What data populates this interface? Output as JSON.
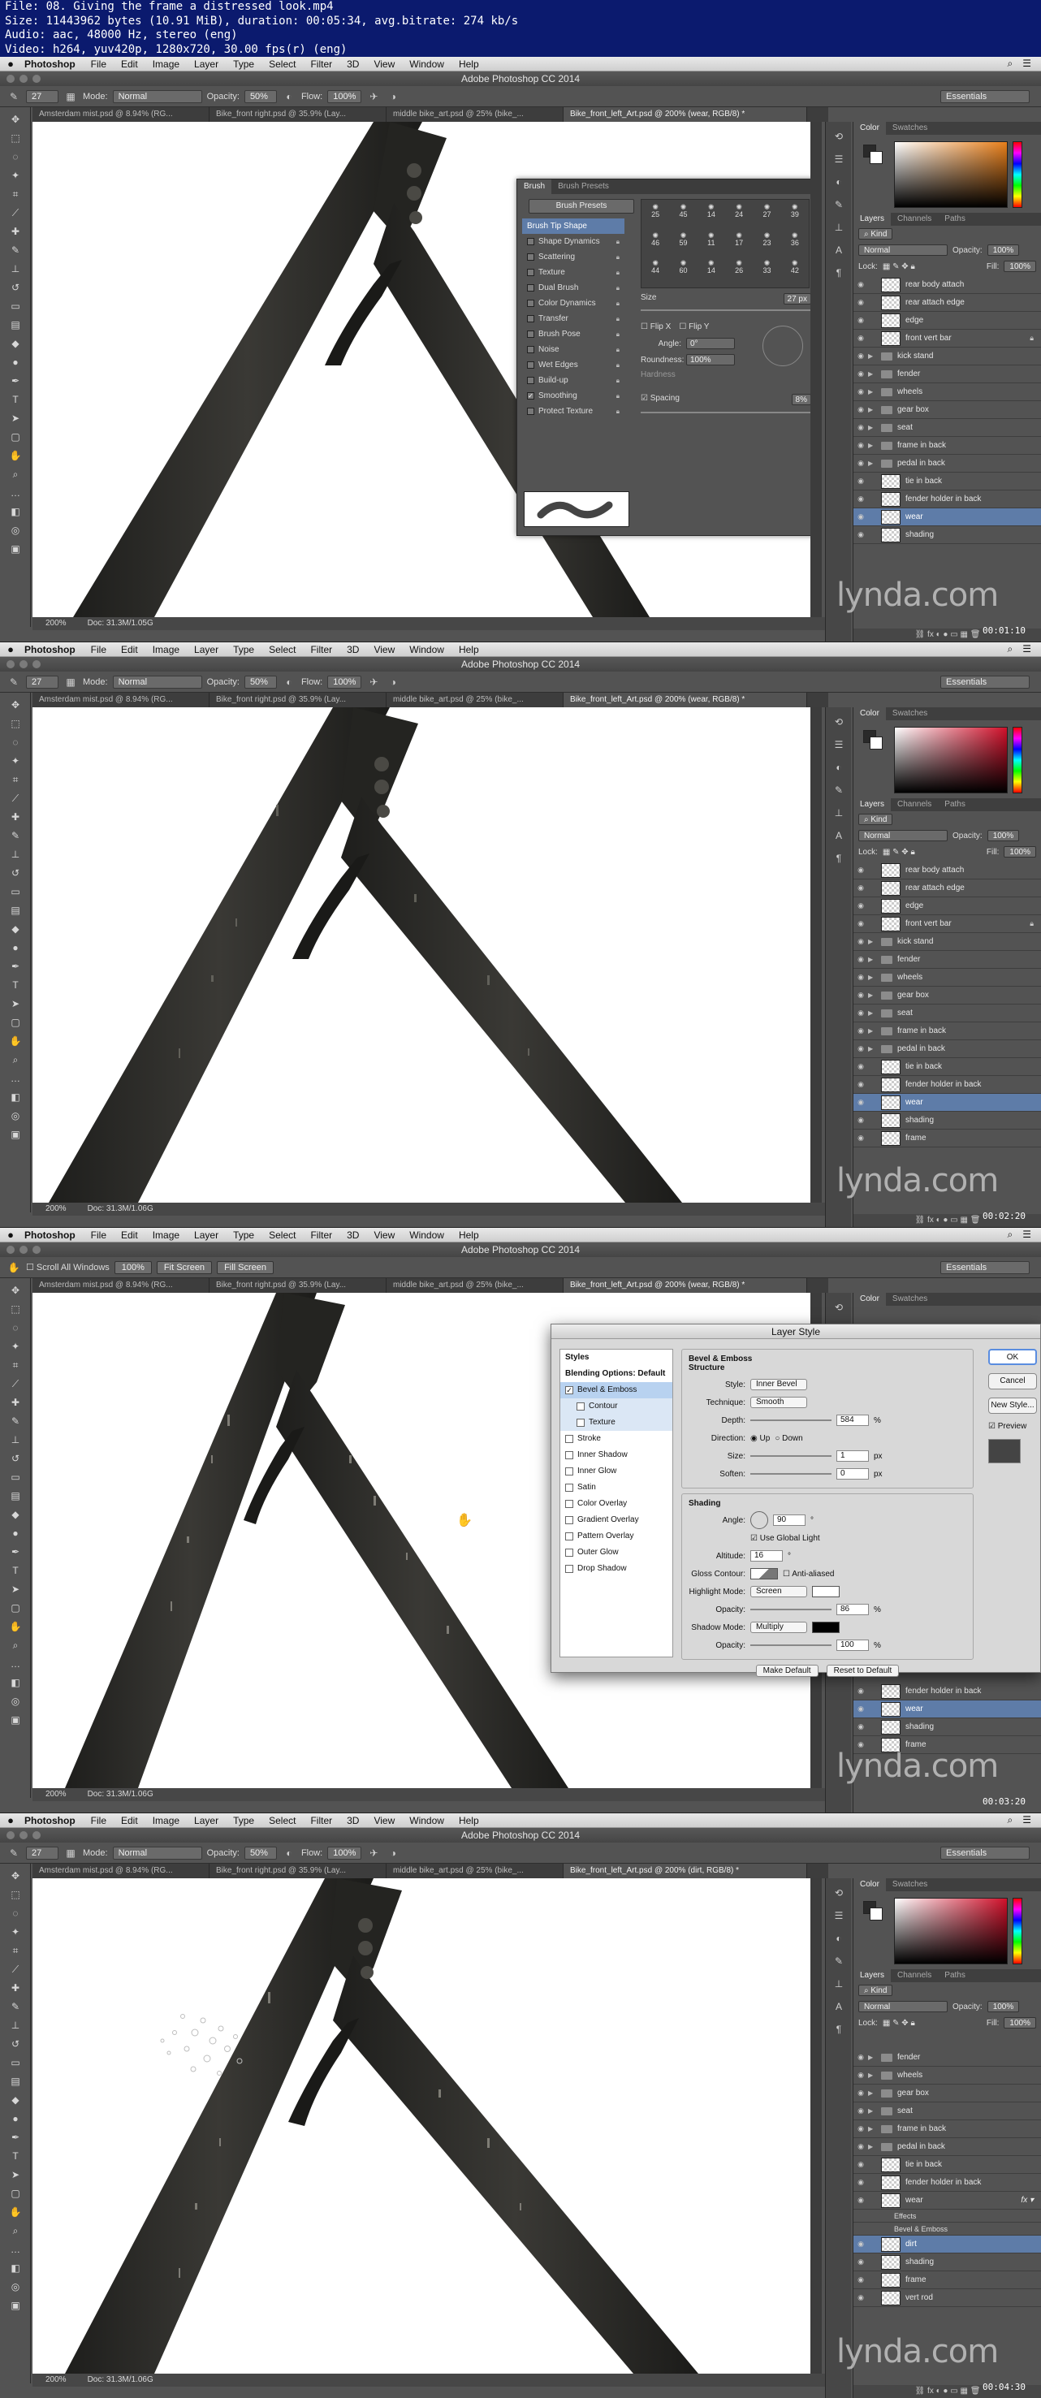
{
  "file_info": [
    "File: 08. Giving the frame a distressed look.mp4",
    "Size: 11443962 bytes (10.91 MiB), duration: 00:05:34, avg.bitrate: 274 kb/s",
    "Audio: aac, 48000 Hz, stereo (eng)",
    "Video: h264, yuv420p, 1280x720, 30.00 fps(r) (eng)"
  ],
  "menubar": {
    "app": "Photoshop",
    "items": [
      "File",
      "Edit",
      "Image",
      "Layer",
      "Type",
      "Select",
      "Filter",
      "3D",
      "View",
      "Window",
      "Help"
    ]
  },
  "window_title": "Adobe Photoshop CC 2014",
  "doc_tabs": [
    "Amsterdam mist.psd @ 8.94% (RG...",
    "Bike_front right.psd @ 35.9% (Lay...",
    "middle bike_art.psd @ 25% (bike_...",
    "Bike_front_left_Art.psd @ 200% (wear, RGB/8) *"
  ],
  "doc_tab_last_dirt": "Bike_front_left_Art.psd @ 200% (dirt, RGB/8) *",
  "options": {
    "mode_label": "Mode:",
    "mode_value": "Normal",
    "opacity_label": "Opacity:",
    "opacity_value": "50%",
    "flow_label": "Flow:",
    "flow_value": "100%",
    "brush_size": "27",
    "workspace": "Essentials",
    "hand_options": [
      "Scroll All Windows",
      "100%",
      "Fit Screen",
      "Fill Screen"
    ]
  },
  "status": {
    "zoom": "200%",
    "doc1": "Doc: 31.3M/1.05G",
    "doc2": "Doc: 31.3M/1.06G"
  },
  "panels": {
    "color_tabs": [
      "Color",
      "Swatches"
    ],
    "layers_tabs": [
      "Layers",
      "Channels",
      "Paths"
    ],
    "kind": "Kind",
    "blend": "Normal",
    "opacity_label": "Opacity:",
    "opacity_value": "100%",
    "lock_label": "Lock:",
    "fill_label": "Fill:",
    "fill_value": "100%"
  },
  "layers1": [
    {
      "name": "rear body attach",
      "type": "layer"
    },
    {
      "name": "rear attach edge",
      "type": "layer"
    },
    {
      "name": "edge",
      "type": "layer"
    },
    {
      "name": "front vert bar",
      "type": "layer",
      "lock": true
    },
    {
      "name": "kick stand",
      "type": "group"
    },
    {
      "name": "fender",
      "type": "group"
    },
    {
      "name": "wheels",
      "type": "group"
    },
    {
      "name": "gear box",
      "type": "group"
    },
    {
      "name": "seat",
      "type": "group"
    },
    {
      "name": "frame in back",
      "type": "group"
    },
    {
      "name": "pedal in back",
      "type": "group"
    },
    {
      "name": "tie in back",
      "type": "layer"
    },
    {
      "name": "fender holder in back",
      "type": "layer"
    },
    {
      "name": "wear",
      "type": "layer",
      "selected": true
    },
    {
      "name": "shading",
      "type": "layer"
    }
  ],
  "layers2": [
    {
      "name": "rear body attach",
      "type": "layer"
    },
    {
      "name": "rear attach edge",
      "type": "layer"
    },
    {
      "name": "edge",
      "type": "layer"
    },
    {
      "name": "front vert bar",
      "type": "layer",
      "lock": true
    },
    {
      "name": "kick stand",
      "type": "group"
    },
    {
      "name": "fender",
      "type": "group"
    },
    {
      "name": "wheels",
      "type": "group"
    },
    {
      "name": "gear box",
      "type": "group"
    },
    {
      "name": "seat",
      "type": "group"
    },
    {
      "name": "frame in back",
      "type": "group"
    },
    {
      "name": "pedal in back",
      "type": "group"
    },
    {
      "name": "tie in back",
      "type": "layer"
    },
    {
      "name": "fender holder in back",
      "type": "layer"
    },
    {
      "name": "wear",
      "type": "layer",
      "selected": true
    },
    {
      "name": "shading",
      "type": "layer"
    },
    {
      "name": "frame",
      "type": "layer"
    }
  ],
  "layers3": [
    {
      "name": "fender holder in back",
      "type": "layer"
    },
    {
      "name": "wear",
      "type": "layer",
      "selected": true
    },
    {
      "name": "shading",
      "type": "layer"
    },
    {
      "name": "frame",
      "type": "layer"
    }
  ],
  "layers4": [
    {
      "name": "fender",
      "type": "group"
    },
    {
      "name": "wheels",
      "type": "group"
    },
    {
      "name": "gear box",
      "type": "group"
    },
    {
      "name": "seat",
      "type": "group"
    },
    {
      "name": "frame in back",
      "type": "group"
    },
    {
      "name": "pedal in back",
      "type": "group"
    },
    {
      "name": "tie in back",
      "type": "layer"
    },
    {
      "name": "fender holder in back",
      "type": "layer"
    },
    {
      "name": "wear",
      "type": "layer",
      "fx": true
    },
    {
      "name": "Effects",
      "type": "sub"
    },
    {
      "name": "Bevel & Emboss",
      "type": "sub"
    },
    {
      "name": "dirt",
      "type": "layer",
      "selected": true
    },
    {
      "name": "shading",
      "type": "layer"
    },
    {
      "name": "frame",
      "type": "layer"
    },
    {
      "name": "vert rod",
      "type": "layer"
    }
  ],
  "brush_panel": {
    "tabs": [
      "Brush",
      "Brush Presets"
    ],
    "presets_button": "Brush Presets",
    "items": [
      {
        "label": "Brush Tip Shape",
        "check": false,
        "hl": true
      },
      {
        "label": "Shape Dynamics",
        "check": false
      },
      {
        "label": "Scattering",
        "check": false
      },
      {
        "label": "Texture",
        "check": false
      },
      {
        "label": "Dual Brush",
        "check": false
      },
      {
        "label": "Color Dynamics",
        "check": false
      },
      {
        "label": "Transfer",
        "check": false
      },
      {
        "label": "Brush Pose",
        "check": false
      },
      {
        "label": "Noise",
        "check": false
      },
      {
        "label": "Wet Edges",
        "check": false
      },
      {
        "label": "Build-up",
        "check": false
      },
      {
        "label": "Smoothing",
        "check": true
      },
      {
        "label": "Protect Texture",
        "check": false
      }
    ],
    "tip_sizes": [
      "25",
      "45",
      "14",
      "24",
      "27",
      "39",
      "46",
      "59",
      "11",
      "17",
      "23",
      "36",
      "44",
      "60",
      "14",
      "26",
      "33",
      "42"
    ],
    "size_label": "Size",
    "size_value": "27 px",
    "flip_x": "Flip X",
    "flip_y": "Flip Y",
    "angle_label": "Angle:",
    "angle_value": "0°",
    "roundness_label": "Roundness:",
    "roundness_value": "100%",
    "hardness_label": "Hardness",
    "spacing_label": "Spacing",
    "spacing_value": "8%"
  },
  "layer_style": {
    "title": "Layer Style",
    "styles_header": "Styles",
    "blending": "Blending Options: Default",
    "items": [
      {
        "label": "Bevel & Emboss",
        "check": true,
        "hl": true
      },
      {
        "label": "Contour",
        "check": false,
        "sub": true
      },
      {
        "label": "Texture",
        "check": false,
        "sub": true
      },
      {
        "label": "Stroke",
        "check": false
      },
      {
        "label": "Inner Shadow",
        "check": false
      },
      {
        "label": "Inner Glow",
        "check": false
      },
      {
        "label": "Satin",
        "check": false
      },
      {
        "label": "Color Overlay",
        "check": false
      },
      {
        "label": "Gradient Overlay",
        "check": false
      },
      {
        "label": "Pattern Overlay",
        "check": false
      },
      {
        "label": "Outer Glow",
        "check": false
      },
      {
        "label": "Drop Shadow",
        "check": false
      }
    ],
    "section": "Bevel & Emboss",
    "structure": "Structure",
    "style_label": "Style:",
    "style_value": "Inner Bevel",
    "technique_label": "Technique:",
    "technique_value": "Smooth",
    "depth_label": "Depth:",
    "depth_value": "584",
    "direction_label": "Direction:",
    "dir_up": "Up",
    "dir_down": "Down",
    "size_label": "Size:",
    "size_value": "1",
    "soften_label": "Soften:",
    "soften_value": "0",
    "shading": "Shading",
    "angle_label": "Angle:",
    "angle_value": "90",
    "global_light": "Use Global Light",
    "altitude_label": "Altitude:",
    "altitude_value": "16",
    "gloss_label": "Gloss Contour:",
    "anti_aliased": "Anti-aliased",
    "highlight_label": "Highlight Mode:",
    "highlight_value": "Screen",
    "h_opacity_label": "Opacity:",
    "h_opacity_value": "86",
    "shadow_label": "Shadow Mode:",
    "shadow_value": "Multiply",
    "s_opacity_label": "Opacity:",
    "s_opacity_value": "100",
    "make_default": "Make Default",
    "reset_default": "Reset to Default",
    "ok": "OK",
    "cancel": "Cancel",
    "new_style": "New Style...",
    "preview": "Preview"
  },
  "watermark": "lynda.com",
  "timecodes": [
    "00:01:10",
    "00:02:20",
    "00:03:20",
    "00:04:30"
  ],
  "colors": {
    "menubar": "#d9d9d9",
    "panel": "#535353",
    "selected_layer": "#5e7ca8",
    "header": "#0b1a6e"
  }
}
